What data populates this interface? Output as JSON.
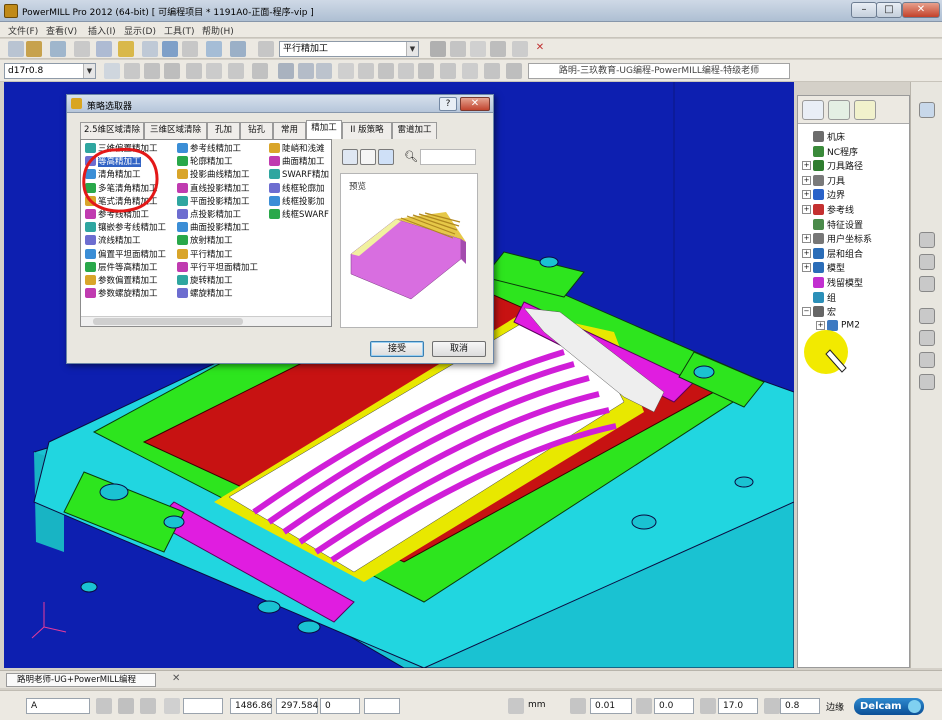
{
  "window": {
    "title": "PowerMILL Pro 2012 (64-bit)    [ 可编程项目 * 1191A0-正面-程序-vip ]"
  },
  "window_controls": {
    "minimize": "–",
    "maximize": "□",
    "close": "✕"
  },
  "menu": [
    "文件(F)",
    "查看(V)",
    "插入(I)",
    "显示(D)",
    "工具(T)",
    "帮助(H)"
  ],
  "toolbar1": {
    "toolpath_select": "平行精加工"
  },
  "toolbar2": {
    "tool_select": "d17r0.8",
    "info_select": "路明-三玖教育-UG编程-PowerMILL编程-特级老师"
  },
  "dialog": {
    "title": "策略选取器",
    "help_btn": "?",
    "close_btn": "✕",
    "tabs": [
      "2.5维区域清除",
      "三维区域清除",
      "孔加",
      "钻孔",
      "常用",
      "精加工",
      "II 版策略",
      "雷道加工"
    ],
    "active_tab_index": 5,
    "strategies_col1": [
      "三维偏置精加工",
      "等高精加工",
      "清角精加工",
      "多笔清角精加工",
      "笔式清角精加工",
      "参考线精加工",
      "镶嵌参考线精加工",
      "流线精加工",
      "偏置平坦面精加工",
      "层件等高精加工",
      "参数偏置精加工",
      "参数螺旋精加工"
    ],
    "strategies_col2": [
      "参考线精加工",
      "轮廓精加工",
      "投影曲线精加工",
      "直线投影精加工",
      "平面投影精加工",
      "点投影精加工",
      "曲面投影精加工",
      "放射精加工",
      "平行精加工",
      "平行平坦面精加工",
      "旋转精加工",
      "螺旋精加工"
    ],
    "strategies_col3": [
      "陡峭和浅滩",
      "曲面精加工",
      "SWARF精加",
      "线框轮廓加",
      "线框投影加",
      "线框SWARF"
    ],
    "selected_strategy": "等高精加工",
    "search_icon": "magnifier-icon",
    "preview_label": "预览",
    "ok": "接受",
    "cancel": "取消"
  },
  "explorer": {
    "items": [
      {
        "label": "机床",
        "expand": "",
        "icon_color": "#6c6c6c"
      },
      {
        "label": "NC程序",
        "expand": "",
        "icon_color": "#3a8a3a"
      },
      {
        "label": "刀具路径",
        "expand": "+",
        "icon_color": "#2f7d2f"
      },
      {
        "label": "刀具",
        "expand": "+",
        "icon_color": "#7a7a7a"
      },
      {
        "label": "边界",
        "expand": "+",
        "icon_color": "#2a62c9"
      },
      {
        "label": "参考线",
        "expand": "+",
        "icon_color": "#c43030"
      },
      {
        "label": "特征设置",
        "expand": "",
        "icon_color": "#4a8a4a"
      },
      {
        "label": "用户坐标系",
        "expand": "+",
        "icon_color": "#777777"
      },
      {
        "label": "层和组合",
        "expand": "+",
        "icon_color": "#2b6db8"
      },
      {
        "label": "模型",
        "expand": "+",
        "icon_color": "#2b6db8"
      },
      {
        "label": "残留模型",
        "expand": "",
        "icon_color": "#c22fd0"
      },
      {
        "label": "组",
        "expand": "",
        "icon_color": "#2b8fb8"
      },
      {
        "label": "宏",
        "expand": "−",
        "icon_color": "#666666"
      },
      {
        "label": "PM2",
        "expand": "+",
        "icon_color": "#3d7ac2"
      }
    ]
  },
  "taskbar": {
    "tab": "路明老师-UG+PowerMILL编程"
  },
  "status": {
    "select": "A",
    "x": "1486.86",
    "y": "297.584",
    "z": "0",
    "units": "mm",
    "tolerance": "0.01",
    "thickness": "0.0",
    "diameter": "17.0",
    "tip_radius": "0.8",
    "label_edge": "边缘",
    "brand": "Delcam"
  },
  "colors": {
    "viewport_bg": "#0d1fb0",
    "annotation": "#e31818",
    "highlight": "#f2ea00"
  }
}
